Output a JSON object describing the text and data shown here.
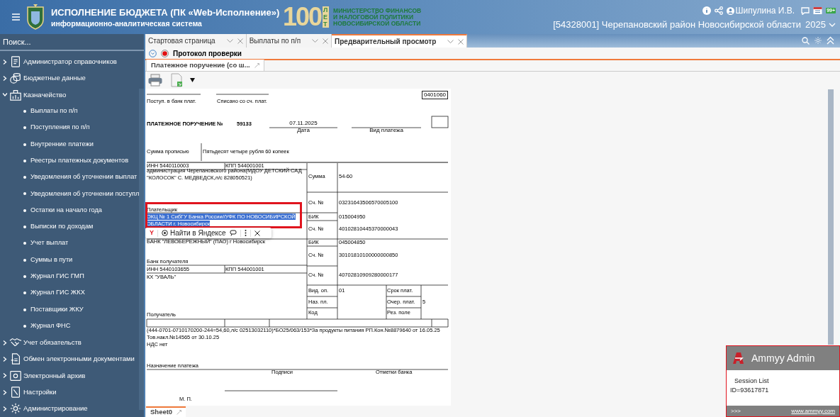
{
  "header": {
    "title": "ИСПОЛНЕНИЕ БЮДЖЕТА (ПК «Web-Исполнение»)",
    "subtitle": "информационно-аналитическая система",
    "logo_number": "100",
    "logo_word": "ЛЕТ",
    "ministry": [
      "МИНИСТЕРСТВО ФИНАНСОВ",
      "И НАЛОГОВОЙ ПОЛИТИКИ",
      "НОВОСИБИРСКОЙ ОБЛАСТИ"
    ],
    "user": "Шипулина И.В.",
    "badge": "99+",
    "region": "[54328001] Черепановский район Новосибирской области",
    "year": "2025"
  },
  "sidebar": {
    "search_placeholder": "Поиск...",
    "items": [
      {
        "label": "Администратор справочников",
        "expanded": false
      },
      {
        "label": "Бюджетные данные",
        "expanded": false
      },
      {
        "label": "Казначейство",
        "expanded": true,
        "children": [
          {
            "label": "Выплаты по п/п"
          },
          {
            "label": "Поступления по п/п"
          },
          {
            "label": "Внутренние платежи"
          },
          {
            "label": "Реестры платежных документов"
          },
          {
            "label": "Уведомления об уточнении выплат"
          },
          {
            "label": "Уведомления об уточнении поступл"
          },
          {
            "label": "Остатки на начало года"
          },
          {
            "label": "Выписки по доходам"
          },
          {
            "label": "Учет выплат"
          },
          {
            "label": "Суммы в пути"
          },
          {
            "label": "Журнал ГИС ГМП"
          },
          {
            "label": "Журнал ГИС ЖКХ"
          },
          {
            "label": "Поставщики ЖКУ"
          },
          {
            "label": "Журнал ФНС"
          }
        ]
      },
      {
        "label": "Учет обязательств",
        "expanded": false
      },
      {
        "label": "Обмен электронными документами",
        "expanded": false
      },
      {
        "label": "Электронный архив",
        "expanded": false
      },
      {
        "label": "Настройки",
        "expanded": false
      },
      {
        "label": "Администрирование",
        "expanded": false
      }
    ]
  },
  "tabs": [
    {
      "label": "Стартовая страница",
      "selected": false
    },
    {
      "label": "Выплаты по п/п",
      "selected": false
    },
    {
      "label": "Предварительный просмотр",
      "selected": true
    }
  ],
  "toolbar": {
    "label": "Протокол проверки"
  },
  "subtabs": [
    {
      "label": "Платежное поручение (со ш...",
      "selected": true
    }
  ],
  "document": {
    "form_code": "0401060",
    "received_label": "Поступ. в банк плат.",
    "debited_label": "Списано со сч. плат.",
    "title": "ПЛАТЕЖНОЕ ПОРУЧЕНИЕ №",
    "number": "59133",
    "date": "07.11.2025",
    "date_label": "Дата",
    "payment_type_label": "Вид платежа",
    "amount_in_words_label": "Сумма прописью",
    "amount_in_words": "Пятьдесят четыре рубля 60 копеек",
    "payer_inn": "ИНН 5440110003",
    "payer_kpp": "КПП 544001001",
    "payer_name": [
      "администрация Черепановского района(МДОУ ДЕТСКИЙ САД",
      "\"КОЛОСОК\" С. МЕДВЕДСК,л/с 828050521)"
    ],
    "amount_label": "Сумма",
    "amount": "54-60",
    "payer_account_label": "Сч. №",
    "payer_account": "03231643506570005100",
    "payer_label": "Плательщик",
    "payer_bank": {
      "lines": [
        "ОКЦ № 1 СибГУ Банка России//УФК ПО НОВОСИБИРСКОЙ",
        "ОБЛАСТИ г. Новосибирск"
      ],
      "selected": true
    },
    "payer_bank_bik_label": "БИК",
    "payer_bank_bik": "015004950",
    "payer_bank_account_label": "Сч. №",
    "payer_bank_account": "40102810445370000043",
    "recipient_bank": "БАНК \"ЛЕВОБЕРЕЖНЫЙ\" (ПАО) г Новосибирск",
    "recipient_bank_bik_label": "БИК",
    "recipient_bank_bik": "045004850",
    "recipient_bank_account_label": "Сч. №",
    "recipient_bank_account": "30101810100000000850",
    "recipient_bank_label": "Банк получателя",
    "recipient_inn": "ИНН 5440103655",
    "recipient_kpp": "КПП 544001001",
    "recipient_name": "КХ \"УВАЛЬ\"",
    "recipient_account_label": "Сч. №",
    "recipient_account": "40702810909280000177",
    "operation_type_label": "Вид. оп.",
    "operation_type": "01",
    "payment_due_label": "Срок плат.",
    "purpose_code_label": "Наз. пл.",
    "priority_label": "Очер. плат.",
    "priority": "5",
    "code_label": "Код",
    "reserve_label": "Рез. поле",
    "recipient_label": "Получатель",
    "purpose": [
      "(444-0701-0710170200-244=54,60,л/с 02513032110)*БО25/063/153*За продукты питания РП.Кон.№8879640 от 16.05.25",
      "Тов.накл.№14565 от 30.10.25",
      "НДС нет"
    ],
    "purpose_label": "Назначение платежа",
    "signatures_label": "Подписи",
    "bank_marks_label": "Отметки банка",
    "stamp_label": "М. П."
  },
  "context_popup": {
    "logo": "Y",
    "action": "Найти в Яндексе"
  },
  "sheet_tabs": [
    {
      "label": "Sheet0",
      "selected": true
    }
  ],
  "ammyy": {
    "title": "Ammyy Admin",
    "session_list": "Session List",
    "id": "ID=93617871",
    "more": ">>>",
    "link": "www.ammyy.com"
  }
}
